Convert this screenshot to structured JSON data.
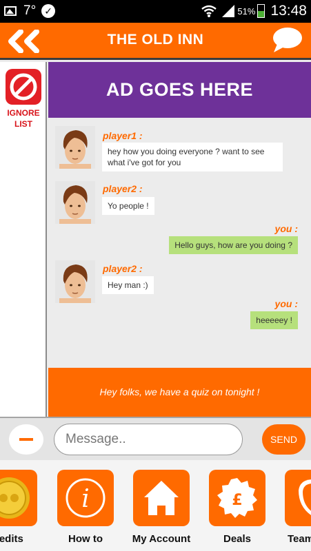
{
  "statusbar": {
    "temperature": "7°",
    "battery": "51%",
    "time": "13:48"
  },
  "header": {
    "title": "THE OLD INN"
  },
  "ignore": {
    "label_line1": "IGNORE",
    "label_line2": "LIST"
  },
  "ad": {
    "text": "AD GOES HERE"
  },
  "messages": [
    {
      "sender": "player1 :",
      "text": "hey how you doing everyone ? want to see what i've got for you"
    },
    {
      "sender": "player2 :",
      "text": "Yo people !"
    },
    {
      "sender": "you :",
      "text": "Hello guys, how are you doing ?"
    },
    {
      "sender": "player2 :",
      "text": "Hey man :)"
    },
    {
      "sender": "you :",
      "text": "heeeeey !"
    }
  ],
  "notice": {
    "text": "Hey folks, we have a quiz on tonight !"
  },
  "input": {
    "placeholder": "Message..",
    "send_label": "SEND"
  },
  "nav": {
    "items": [
      {
        "label": "Credits",
        "icon": "coin-icon"
      },
      {
        "label": "How to",
        "icon": "info-icon"
      },
      {
        "label": "My Account",
        "icon": "home-icon"
      },
      {
        "label": "Deals",
        "icon": "deals-badge-icon"
      },
      {
        "label": "Team",
        "icon": "team-badge-icon"
      }
    ]
  },
  "colors": {
    "brand_orange": "#ff6a00",
    "ad_purple": "#6e3199",
    "own_bubble": "#b6e07c",
    "ignore_red": "#e32026"
  }
}
